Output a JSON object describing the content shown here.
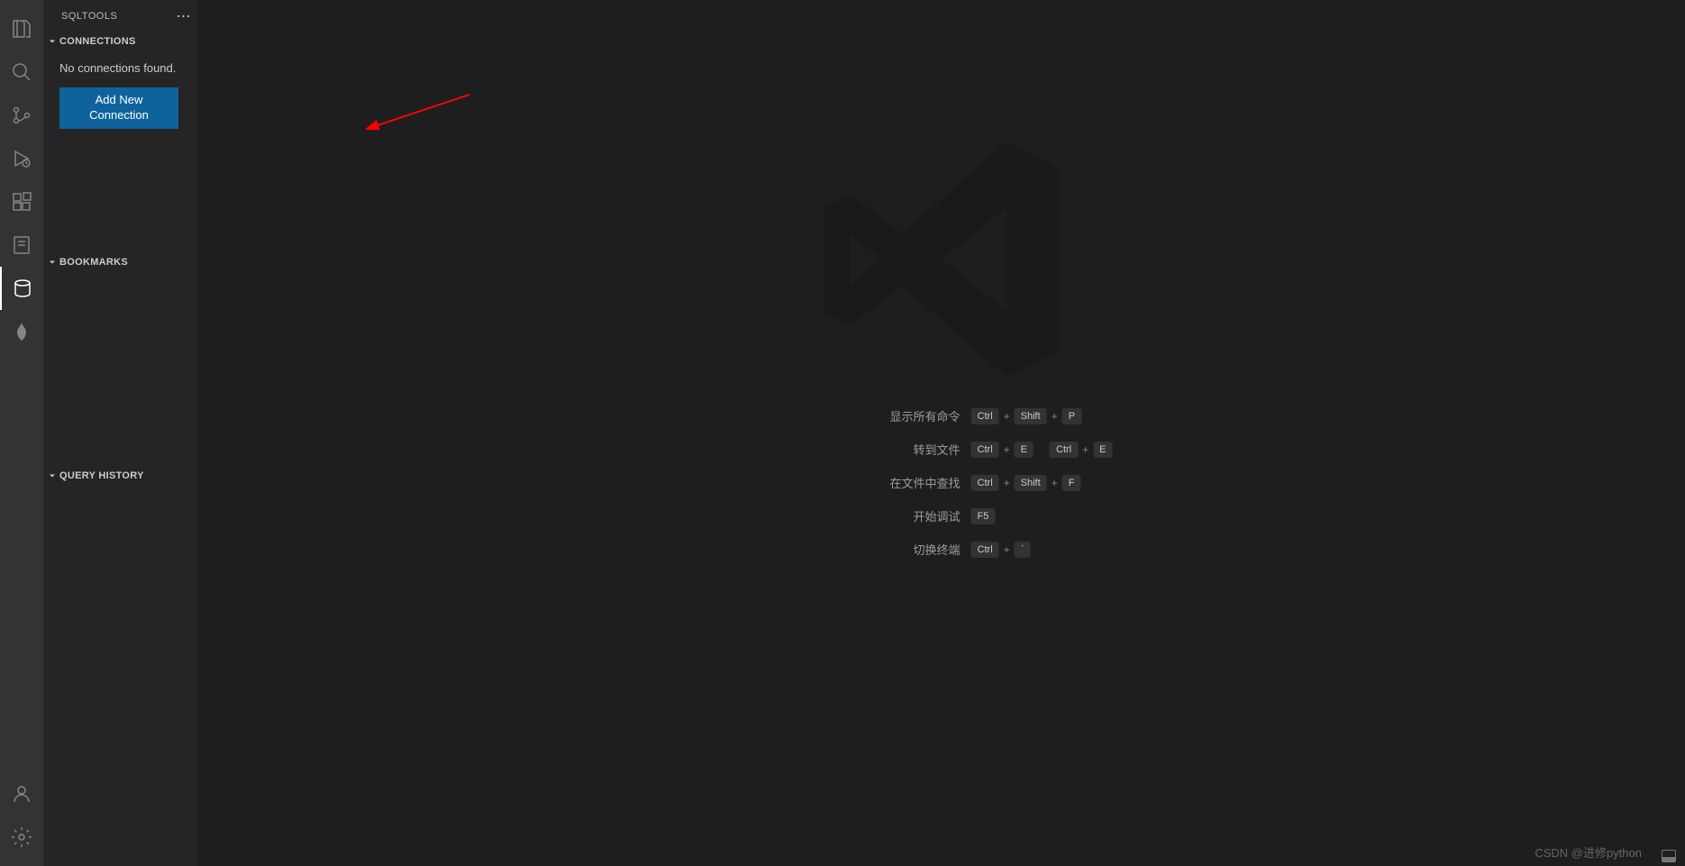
{
  "sidebar": {
    "title": "SQLTOOLS",
    "sections": {
      "connections": {
        "label": "CONNECTIONS",
        "empty_text": "No connections found.",
        "button_label": "Add New Connection"
      },
      "bookmarks": {
        "label": "BOOKMARKS"
      },
      "history": {
        "label": "QUERY HISTORY"
      }
    }
  },
  "welcome": {
    "shortcuts": [
      {
        "label": "显示所有命令",
        "keys": [
          "Ctrl",
          "Shift",
          "P"
        ]
      },
      {
        "label": "转到文件",
        "keys": [
          "Ctrl",
          "E"
        ],
        "keys2": [
          "Ctrl",
          "E"
        ]
      },
      {
        "label": "在文件中查找",
        "keys": [
          "Ctrl",
          "Shift",
          "F"
        ]
      },
      {
        "label": "开始调试",
        "keys": [
          "F5"
        ]
      },
      {
        "label": "切换终端",
        "keys": [
          "Ctrl",
          "`"
        ]
      }
    ]
  },
  "watermark": "CSDN @进修python"
}
